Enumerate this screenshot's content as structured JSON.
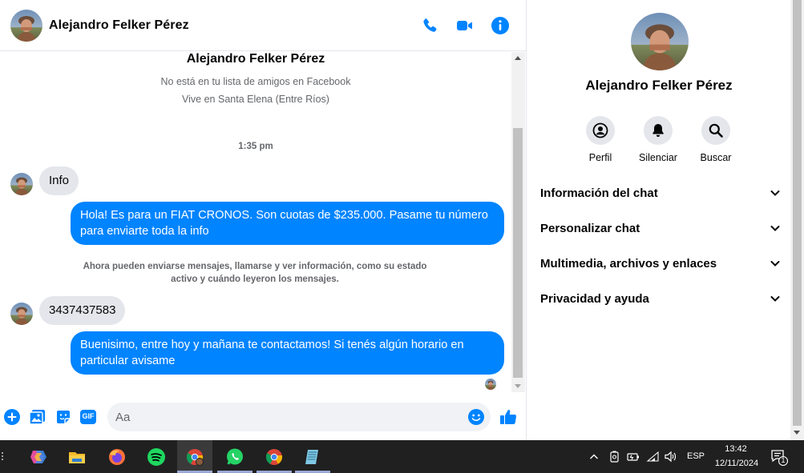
{
  "chat": {
    "contact_name": "Alejandro Felker Pérez",
    "intro": {
      "name": "Alejandro Felker Pérez",
      "friends_status": "No está en tu lista de amigos en Facebook",
      "location": "Vive en Santa Elena (Entre Ríos)"
    },
    "timestamp": "1:35 pm",
    "messages": [
      {
        "direction": "incoming",
        "text": "Info"
      },
      {
        "direction": "outgoing",
        "text": "Hola! Es para un FIAT CRONOS. Son cuotas de $235.000. Pasame tu número para enviarte toda la info"
      },
      {
        "direction": "system",
        "text_line1": "Ahora pueden enviarse mensajes, llamarse y ver información, como su estado",
        "text_line2": "activo y cuándo leyeron los mensajes."
      },
      {
        "direction": "incoming",
        "text": "3437437583"
      },
      {
        "direction": "outgoing",
        "text": "Buenisimo, entre hoy y mañana te contactamos! Si tenés algún horario en particular avisame"
      }
    ],
    "composer": {
      "placeholder": "Aa",
      "gif_label": "GIF"
    }
  },
  "side_panel": {
    "name": "Alejandro Felker Pérez",
    "actions": [
      {
        "label": "Perfil",
        "icon": "profile-icon"
      },
      {
        "label": "Silenciar",
        "icon": "bell-icon"
      },
      {
        "label": "Buscar",
        "icon": "search-icon"
      }
    ],
    "sections": [
      {
        "label": "Información del chat"
      },
      {
        "label": "Personalizar chat"
      },
      {
        "label": "Multimedia, archivos y enlaces"
      },
      {
        "label": "Privacidad y ayuda"
      }
    ]
  },
  "taskbar": {
    "apps": [
      "copilot-icon",
      "file-explorer-icon",
      "firefox-icon",
      "spotify-icon",
      "chrome-profile-icon",
      "whatsapp-icon",
      "chrome-icon",
      "notepad-icon"
    ],
    "language": "ESP",
    "time": "13:42",
    "date": "12/11/2024",
    "notification_count": "1"
  },
  "colors": {
    "accent": "#0084ff",
    "incoming_bubble": "#e4e6eb",
    "taskbar": "#202020"
  }
}
